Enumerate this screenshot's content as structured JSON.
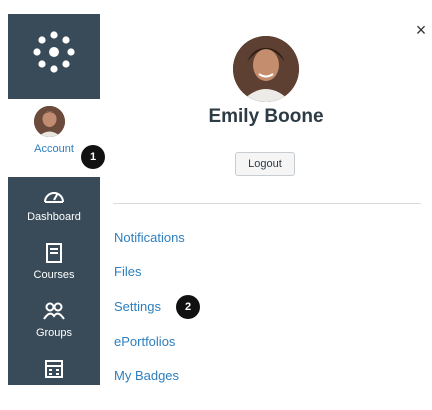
{
  "global_nav": {
    "account_label": "Account",
    "items": [
      {
        "label": "Dashboard",
        "icon": "dashboard-icon"
      },
      {
        "label": "Courses",
        "icon": "courses-icon"
      },
      {
        "label": "Groups",
        "icon": "groups-icon"
      },
      {
        "label": "Calendar",
        "icon": "calendar-icon"
      }
    ],
    "colors": {
      "nav_bg": "#394b58",
      "link": "#2d7fbf"
    }
  },
  "callouts": [
    "1",
    "2"
  ],
  "tray": {
    "close_glyph": "×",
    "user_name": "Emily Boone",
    "logout_label": "Logout",
    "links": [
      "Notifications",
      "Files",
      "Settings",
      "ePortfolios",
      "My Badges"
    ]
  }
}
